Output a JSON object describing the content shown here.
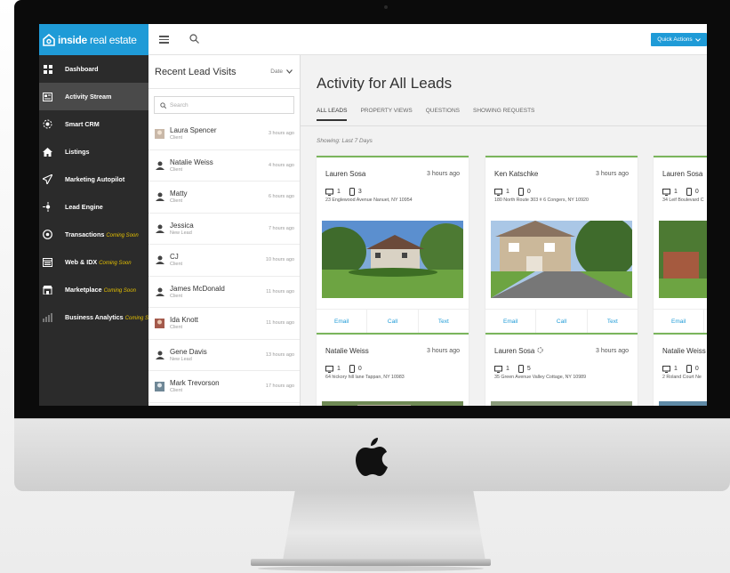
{
  "brand": {
    "name_bold": "inside",
    "name_light": "real estate"
  },
  "topbar": {
    "quick_actions": "Quick Actions"
  },
  "sidebar": {
    "items": [
      {
        "label": "Dashboard",
        "icon": "dashboard-icon",
        "soon": ""
      },
      {
        "label": "Activity Stream",
        "icon": "activity-icon",
        "soon": ""
      },
      {
        "label": "Smart CRM",
        "icon": "crm-icon",
        "soon": ""
      },
      {
        "label": "Listings",
        "icon": "home-icon",
        "soon": ""
      },
      {
        "label": "Marketing Autopilot",
        "icon": "paper-plane-icon",
        "soon": ""
      },
      {
        "label": "Lead Engine",
        "icon": "lead-engine-icon",
        "soon": ""
      },
      {
        "label": "Transactions",
        "icon": "transactions-icon",
        "soon": "Coming Soon"
      },
      {
        "label": "Web & IDX",
        "icon": "web-icon",
        "soon": "Coming Soon"
      },
      {
        "label": "Marketplace",
        "icon": "marketplace-icon",
        "soon": "Coming Soon"
      },
      {
        "label": "Business Analytics",
        "icon": "analytics-icon",
        "soon": "Coming Soon"
      }
    ]
  },
  "recent": {
    "title": "Recent Lead Visits",
    "sort_label": "Date",
    "search_placeholder": "Search",
    "leads": [
      {
        "name": "Laura Spencer",
        "type": "Client",
        "time": "3 hours ago"
      },
      {
        "name": "Natalie Weiss",
        "type": "Client",
        "time": "4 hours ago"
      },
      {
        "name": "Matty",
        "type": "Client",
        "time": "6 hours ago"
      },
      {
        "name": "Jessica",
        "type": "New Lead",
        "time": "7 hours ago"
      },
      {
        "name": "CJ",
        "type": "Client",
        "time": "10 hours ago"
      },
      {
        "name": "James McDonald",
        "type": "Client",
        "time": "11 hours ago"
      },
      {
        "name": "Ida Knott",
        "type": "Client",
        "time": "11 hours ago"
      },
      {
        "name": "Gene Davis",
        "type": "New Lead",
        "time": "13 hours ago"
      },
      {
        "name": "Mark Trevorson",
        "type": "Client",
        "time": "17 hours ago"
      }
    ]
  },
  "activity": {
    "title": "Activity for All Leads",
    "tabs": [
      "ALL LEADS",
      "PROPERTY VIEWS",
      "QUESTIONS",
      "SHOWING REQUESTS"
    ],
    "showing": "Showing: Last 7 Days",
    "actions": {
      "email": "Email",
      "call": "Call",
      "text": "Text"
    },
    "cards": [
      {
        "name": "Lauren Sosa",
        "time": "3 hours ago",
        "desktop": "1",
        "mobile": "3",
        "address": "23 Englewood Avenue Nanuet, NY 10954"
      },
      {
        "name": "Ken Katschke",
        "time": "3 hours ago",
        "desktop": "1",
        "mobile": "0",
        "address": "180 North Route 303 # 6 Congers, NY 10920"
      },
      {
        "name": "Lauren Sosa",
        "time": "",
        "desktop": "1",
        "mobile": "0",
        "address": "34 Leif Boulevard C"
      },
      {
        "name": "Natalie Weiss",
        "time": "3 hours ago",
        "desktop": "1",
        "mobile": "0",
        "address": "64 hickory hill lane Tappan, NY 10983"
      },
      {
        "name": "Lauren Sosa",
        "time": "3 hours ago",
        "desktop": "1",
        "mobile": "5",
        "address": "35 Green Avenue Valley Cottage, NY 10989"
      },
      {
        "name": "Natalie Weiss",
        "time": "",
        "desktop": "1",
        "mobile": "0",
        "address": "2 Roland Court Ne"
      }
    ]
  },
  "colors": {
    "accent": "#1f9bd7",
    "card_border": "#7ab55c",
    "sidebar": "#2b2b2b",
    "coming_soon": "#e7c200"
  }
}
